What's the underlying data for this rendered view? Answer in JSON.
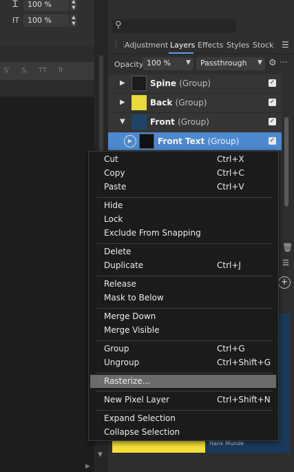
{
  "character_panel": {
    "leading_icon": "Ꮖ",
    "leading_value": "100 %",
    "tracking_icon": "IT",
    "tracking_value": "100 %",
    "style_buttons": [
      "S'",
      "S,",
      "TT",
      "Tr"
    ]
  },
  "studio": {
    "tabs": [
      {
        "label": "Adjustment",
        "active": false
      },
      {
        "label": "Layers",
        "active": true
      },
      {
        "label": "Effects",
        "active": false
      },
      {
        "label": "Styles",
        "active": false
      },
      {
        "label": "Stock",
        "active": false
      }
    ],
    "opacity_label": "Opacity:",
    "opacity_value": "100 %",
    "blend_mode": "Passthrough"
  },
  "layers": [
    {
      "name": "Spine",
      "type": "(Group)",
      "expanded": false,
      "checked": "✓"
    },
    {
      "name": "Back",
      "type": "(Group)",
      "expanded": false,
      "checked": "✓"
    },
    {
      "name": "Front",
      "type": "(Group)",
      "expanded": true,
      "checked": "✓"
    },
    {
      "name": "Front Text",
      "type": "(Group)",
      "expanded": false,
      "checked": "✓",
      "selected": true
    }
  ],
  "preview": {
    "caption": "Hank Munde"
  },
  "context_menu": {
    "groups": [
      [
        {
          "label": "Cut",
          "shortcut": "Ctrl+X"
        },
        {
          "label": "Copy",
          "shortcut": "Ctrl+C"
        },
        {
          "label": "Paste",
          "shortcut": "Ctrl+V"
        }
      ],
      [
        {
          "label": "Hide",
          "shortcut": ""
        },
        {
          "label": "Lock",
          "shortcut": ""
        },
        {
          "label": "Exclude From Snapping",
          "shortcut": ""
        }
      ],
      [
        {
          "label": "Delete",
          "shortcut": ""
        },
        {
          "label": "Duplicate",
          "shortcut": "Ctrl+J"
        }
      ],
      [
        {
          "label": "Release",
          "shortcut": ""
        },
        {
          "label": "Mask to Below",
          "shortcut": ""
        }
      ],
      [
        {
          "label": "Merge Down",
          "shortcut": ""
        },
        {
          "label": "Merge Visible",
          "shortcut": ""
        }
      ],
      [
        {
          "label": "Group",
          "shortcut": "Ctrl+G"
        },
        {
          "label": "Ungroup",
          "shortcut": "Ctrl+Shift+G"
        }
      ],
      [
        {
          "label": "Rasterize...",
          "shortcut": "",
          "highlighted": true
        }
      ],
      [
        {
          "label": "New Pixel Layer",
          "shortcut": "Ctrl+Shift+N"
        }
      ],
      [
        {
          "label": "Expand Selection",
          "shortcut": ""
        },
        {
          "label": "Collapse Selection",
          "shortcut": ""
        }
      ]
    ]
  }
}
